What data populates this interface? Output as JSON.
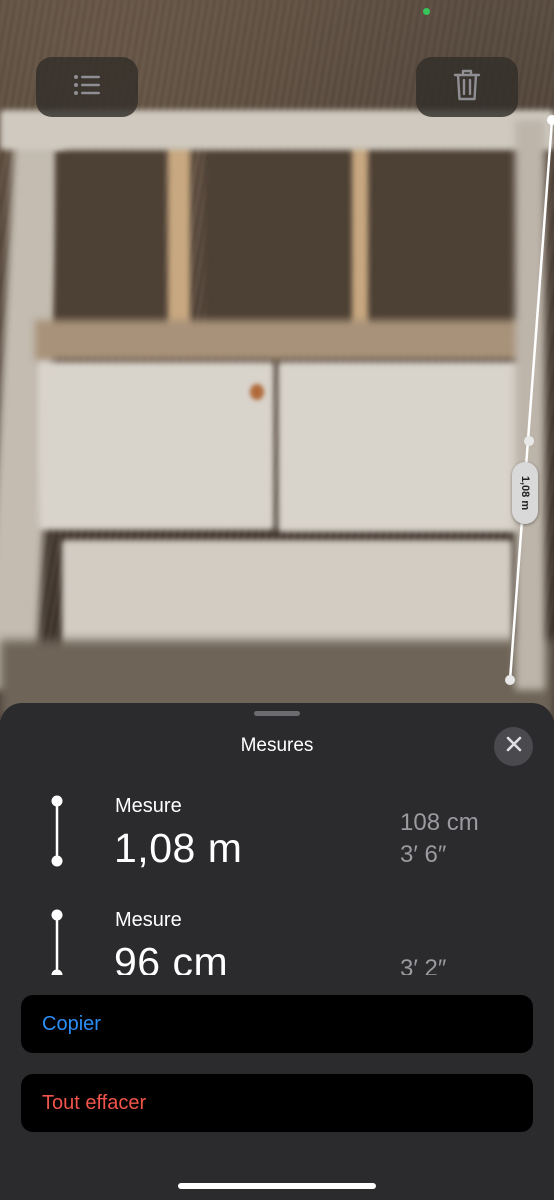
{
  "toolbar": {
    "list_icon": "list-icon",
    "trash_icon": "trash-icon"
  },
  "ar": {
    "measurement_label": "1,08 m"
  },
  "sheet": {
    "title": "Mesures",
    "close_icon": "close-icon",
    "measurements": [
      {
        "label": "Mesure",
        "value": "1,08 m",
        "alt_metric": "108 cm",
        "alt_imperial": "3′ 6″"
      },
      {
        "label": "Mesure",
        "value": "96 cm",
        "alt_metric": "",
        "alt_imperial": "3′ 2″"
      }
    ],
    "copy_label": "Copier",
    "clear_label": "Tout effacer"
  },
  "colors": {
    "accent_blue": "#2b8ef5",
    "destructive_red": "#f0544a",
    "status_green": "#35c759"
  }
}
